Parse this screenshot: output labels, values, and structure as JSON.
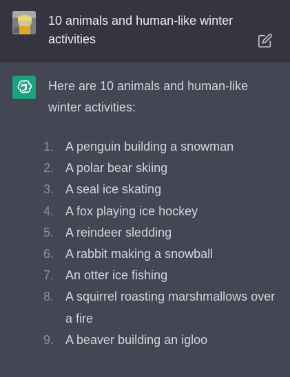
{
  "user_message": {
    "text": "10 animals and human-like winter activities"
  },
  "assistant_message": {
    "intro": "Here are 10 animals and human-like winter activities:",
    "items": [
      {
        "num": "1.",
        "text": "A penguin building a snowman"
      },
      {
        "num": "2.",
        "text": "A polar bear skiing"
      },
      {
        "num": "3.",
        "text": "A seal ice skating"
      },
      {
        "num": "4.",
        "text": "A fox playing ice hockey"
      },
      {
        "num": "5.",
        "text": "A reindeer sledding"
      },
      {
        "num": "6.",
        "text": "A rabbit making a snowball"
      },
      {
        "num": "7.",
        "text": "An otter ice fishing"
      },
      {
        "num": "8.",
        "text": "A squirrel roasting marshmallows over a fire"
      },
      {
        "num": "9.",
        "text": "A beaver building an igloo"
      }
    ]
  },
  "icons": {
    "user_avatar": "user-avatar",
    "edit": "edit-icon",
    "assistant_logo": "openai-logo-icon"
  },
  "colors": {
    "user_row_bg": "#343541",
    "assistant_row_bg": "#444654",
    "assistant_logo_bg": "#19a37f",
    "text": "#ececf1",
    "muted_number": "#8e8ea0"
  }
}
